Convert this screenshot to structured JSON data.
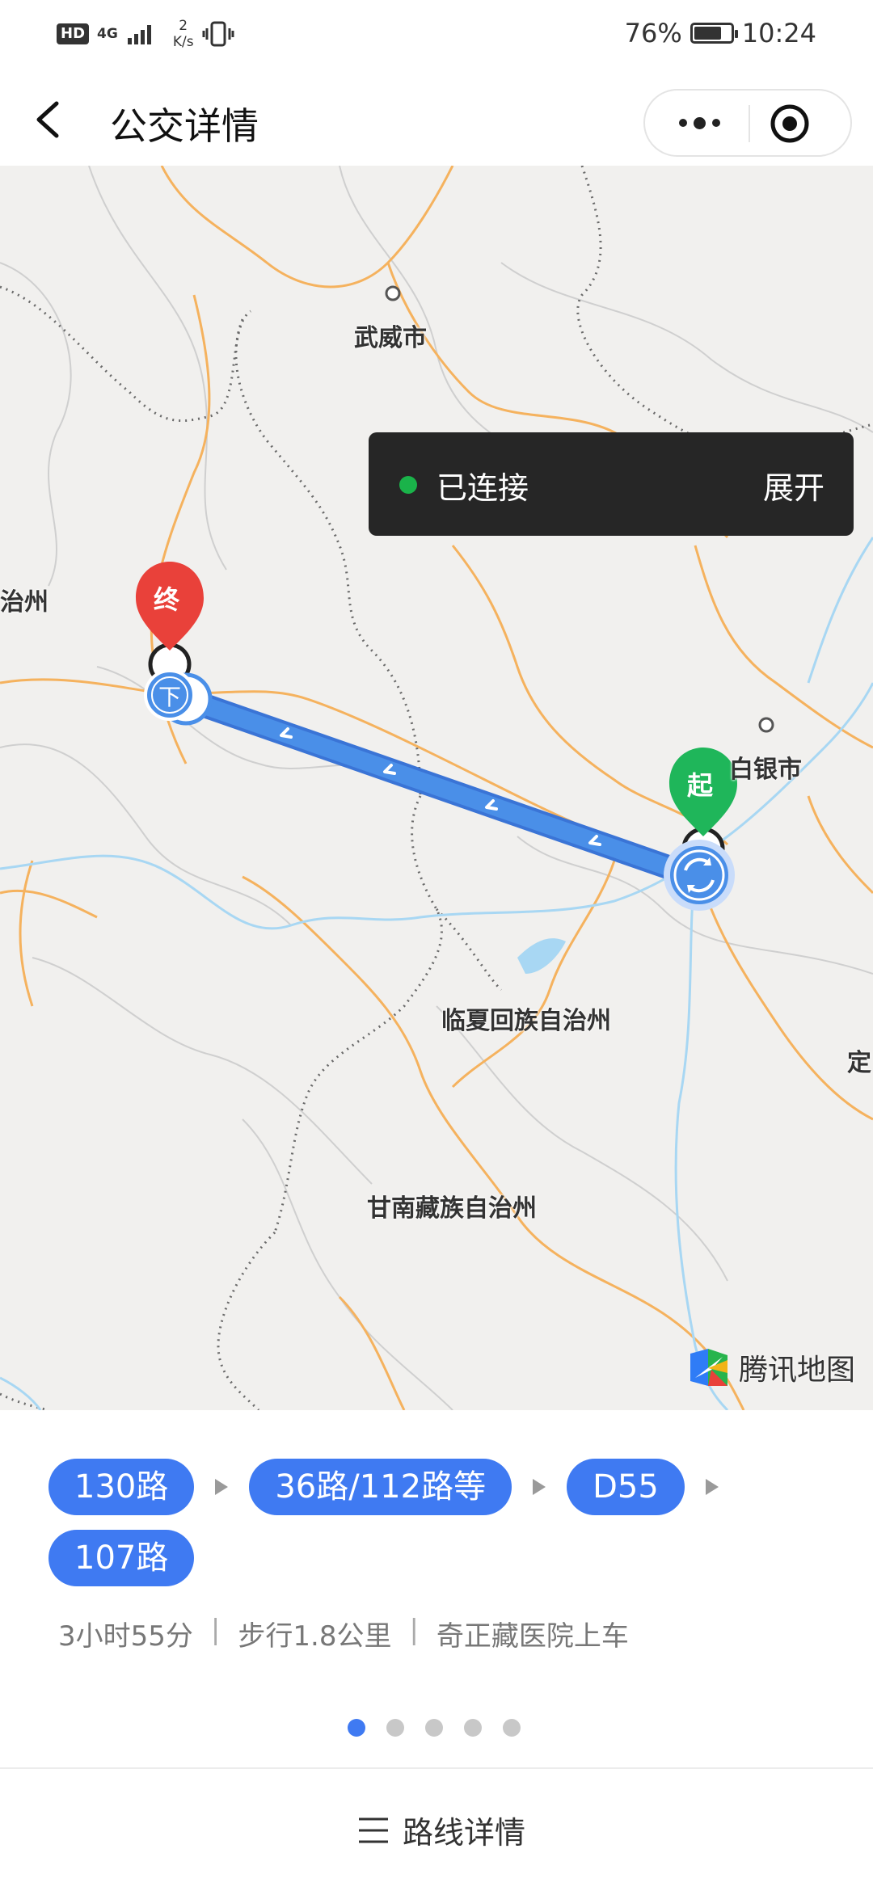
{
  "status_bar": {
    "hd": "HD",
    "network": "4G",
    "speed_value": "2",
    "speed_unit": "K/s",
    "battery": "76%",
    "battery_level": 0.76,
    "time": "10:24"
  },
  "nav": {
    "title": "公交详情",
    "back_icon": "chevron-left-icon",
    "more_icon": "more-dots-icon",
    "close_icon": "target-circle-icon"
  },
  "map": {
    "cities": {
      "wuwei": "武威市",
      "zhizhou": "治州",
      "baiyin": "白银市",
      "linxia": "临夏回族自治州",
      "gannan": "甘南藏族自治州",
      "ding": "定"
    },
    "connection": {
      "status": "已连接",
      "expand": "展开",
      "status_color": "#1ab34a"
    },
    "markers": {
      "end": "终",
      "start": "起",
      "alight": "下"
    },
    "brand": "腾讯地图",
    "route_color": "#4a8fe8"
  },
  "route": {
    "line1": "130路",
    "line2": "36路/112路等",
    "line3": "D55",
    "line4": "107路",
    "duration": "3小时55分",
    "walk": "步行1.8公里",
    "board": "奇正藏医院上车",
    "separator": "|"
  },
  "pager": {
    "count": 5,
    "active": 0
  },
  "footer": {
    "detail_label": "路线详情",
    "menu_icon": "list-icon"
  },
  "colors": {
    "accent": "#3f7af2",
    "end_marker": "#e9413a",
    "start_marker": "#1fb65a"
  }
}
